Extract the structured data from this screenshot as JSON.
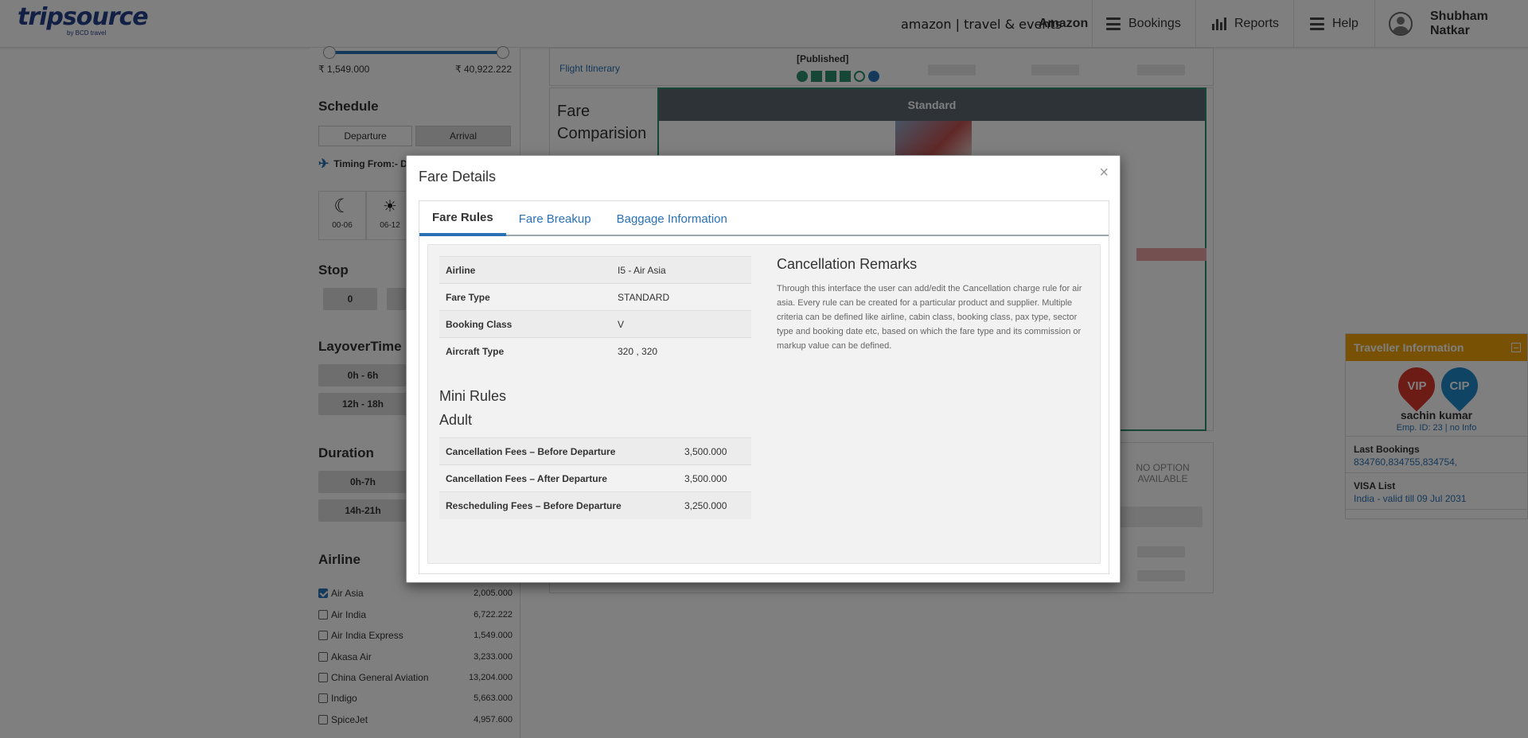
{
  "header": {
    "logo_text": "tripsource",
    "logo_sub": "by BCD travel",
    "amazon_logo": "amazon | travel & events",
    "company": "Amazon",
    "nav": [
      {
        "label": "Bookings",
        "icon": "menu-icon"
      },
      {
        "label": "Reports",
        "icon": "bar-chart-icon"
      },
      {
        "label": "Help",
        "icon": "menu-icon"
      }
    ],
    "user_name": "Shubham Natkar"
  },
  "filters": {
    "price_min": "₹ 1,549.000",
    "price_max": "₹ 40,922.222",
    "schedule_title": "Schedule",
    "schedule_tabs": [
      "Departure",
      "Arrival"
    ],
    "timing_label": "Timing From:- D",
    "time_slots": [
      "00-06",
      "06-12"
    ],
    "stop_title": "Stop",
    "stop_options": [
      "0"
    ],
    "layover_title": "LayoverTime",
    "layover_options": [
      "0h - 6h",
      "12h - 18h"
    ],
    "duration_title": "Duration",
    "duration_options": [
      "0h-7h",
      "14h-21h"
    ],
    "airline_title": "Airline",
    "airlines": [
      {
        "name": "Air Asia",
        "price": "2,005.000",
        "checked": true
      },
      {
        "name": "Air India",
        "price": "6,722.222",
        "checked": false
      },
      {
        "name": "Air India Express",
        "price": "1,549.000",
        "checked": false
      },
      {
        "name": "Akasa Air",
        "price": "3,233.000",
        "checked": false
      },
      {
        "name": "China General Aviation",
        "price": "13,204.000",
        "checked": false
      },
      {
        "name": "Indigo",
        "price": "5,663.000",
        "checked": false
      },
      {
        "name": "SpiceJet",
        "price": "4,957.600",
        "checked": false
      }
    ]
  },
  "results": {
    "published_label": "[Published]",
    "itinerary_link": "Flight Itinerary",
    "fare_comparison_title": "Fare Comparision",
    "standard_label": "Standard",
    "no_option": "NO OPTION AVAILABLE"
  },
  "traveller": {
    "title": "Traveller Information",
    "badges": [
      "VIP",
      "CIP"
    ],
    "name": "sachin kumar",
    "emp_info": "Emp. ID: 23 | no Info",
    "last_bookings_label": "Last Bookings",
    "last_bookings_value": "834760,834755,834754,",
    "visa_label": "VISA List",
    "visa_value": "India - valid till 09 Jul 2031"
  },
  "modal": {
    "title": "Fare Details",
    "close": "×",
    "tabs": [
      "Fare Rules",
      "Fare Breakup",
      "Baggage Information"
    ],
    "info_rows": [
      {
        "label": "Airline",
        "value": "I5 - Air Asia"
      },
      {
        "label": "Fare Type",
        "value": "STANDARD"
      },
      {
        "label": "Booking Class",
        "value": "V"
      },
      {
        "label": "Aircraft Type",
        "value": "320 , 320"
      }
    ],
    "mini_rules_title": "Mini Rules",
    "pax_type": "Adult",
    "fee_rows": [
      {
        "label": "Cancellation Fees – Before Departure",
        "value": "3,500.000"
      },
      {
        "label": "Cancellation Fees – After Departure",
        "value": "3,500.000"
      },
      {
        "label": "Rescheduling Fees – Before Departure",
        "value": "3,250.000"
      }
    ],
    "remarks_title": "Cancellation Remarks",
    "remarks_text": "Through this interface the user can add/edit the Cancellation charge rule for air asia. Every rule can be created for a particular product and supplier. Multiple criteria can be defined like airline, cabin class, booking class, pax type, sector type and booking date etc, based on which the fare type and its commission or markup value can be defined."
  },
  "colors": {
    "accent": "#2a72b5",
    "traveller_header": "#f0a30a",
    "standard_header": "#5c6670",
    "vip": "#d9362b",
    "cip": "#1f88c9"
  }
}
